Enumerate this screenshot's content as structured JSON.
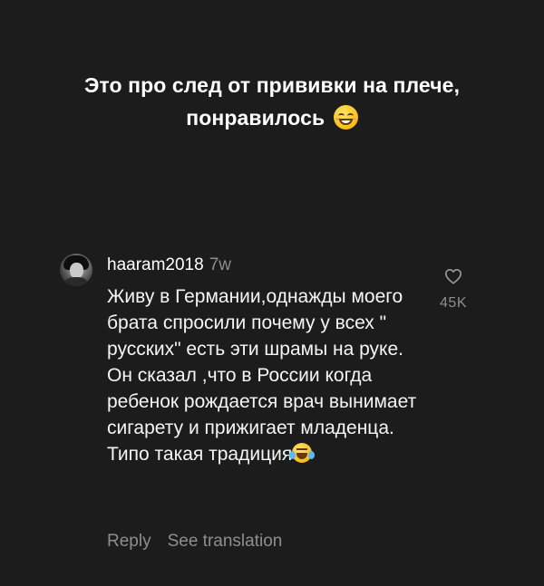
{
  "caption": {
    "line1": "Это про след от прививки на плече,",
    "line2": "понравилось",
    "emoji": "grinning-face-emoji"
  },
  "comment": {
    "username": "haaram2018",
    "time": "7w",
    "text": "Живу в Германии,однажды моего брата спросили почему у всех \" русских\" есть эти шрамы на руке. Он сказал ,что в России когда ребенок рождается врач вынимает сигарету и прижигает младенца. Типо такая традиция",
    "text_emoji": "face-with-tears-of-joy-emoji",
    "like_icon": "heart-outline-icon",
    "like_count": "45K",
    "actions": {
      "reply": "Reply",
      "see_translation": "See translation"
    }
  }
}
